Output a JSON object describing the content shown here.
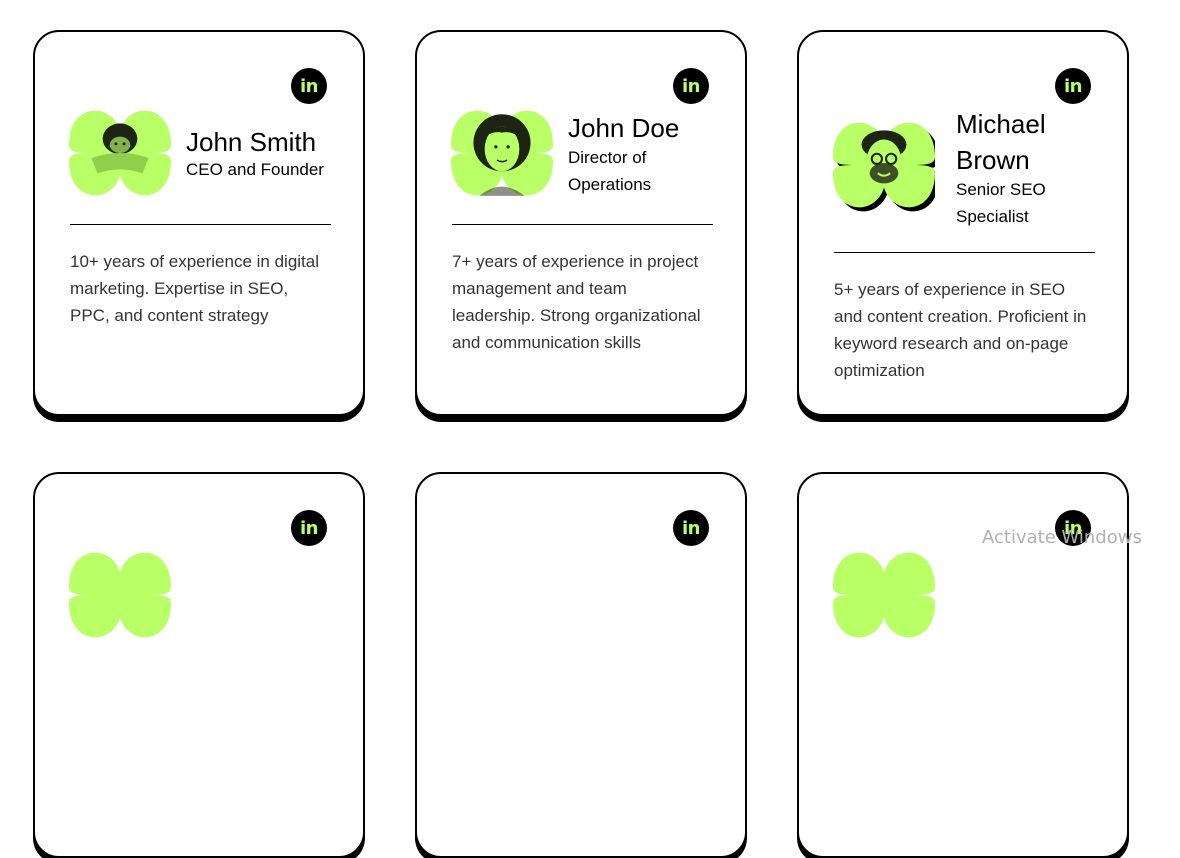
{
  "team": [
    {
      "name": "John Smith",
      "role": "CEO and Founder",
      "bio": "10+ years of experience in digital marketing. Expertise in SEO, PPC, and content strategy",
      "linkedin_label": "in"
    },
    {
      "name": "John Doe",
      "role": "Director of Operations",
      "bio": "7+ years of experience in project management and team leadership. Strong organizational and communication skills",
      "linkedin_label": "in"
    },
    {
      "name": "Michael Brown",
      "role": "Senior SEO Specialist",
      "bio": "5+ years of experience in SEO and content creation. Proficient in keyword research and on-page optimization",
      "linkedin_label": "in"
    },
    {
      "linkedin_label": "in"
    },
    {
      "linkedin_label": "in"
    },
    {
      "linkedin_label": "in"
    }
  ],
  "watermark": "Activate Windows",
  "colors": {
    "accent": "#b9ff66",
    "dark": "#000000",
    "card_bg": "#ffffff"
  },
  "icons": {
    "linkedin": "linkedin-icon",
    "avatar_shape": "flower-blob"
  }
}
